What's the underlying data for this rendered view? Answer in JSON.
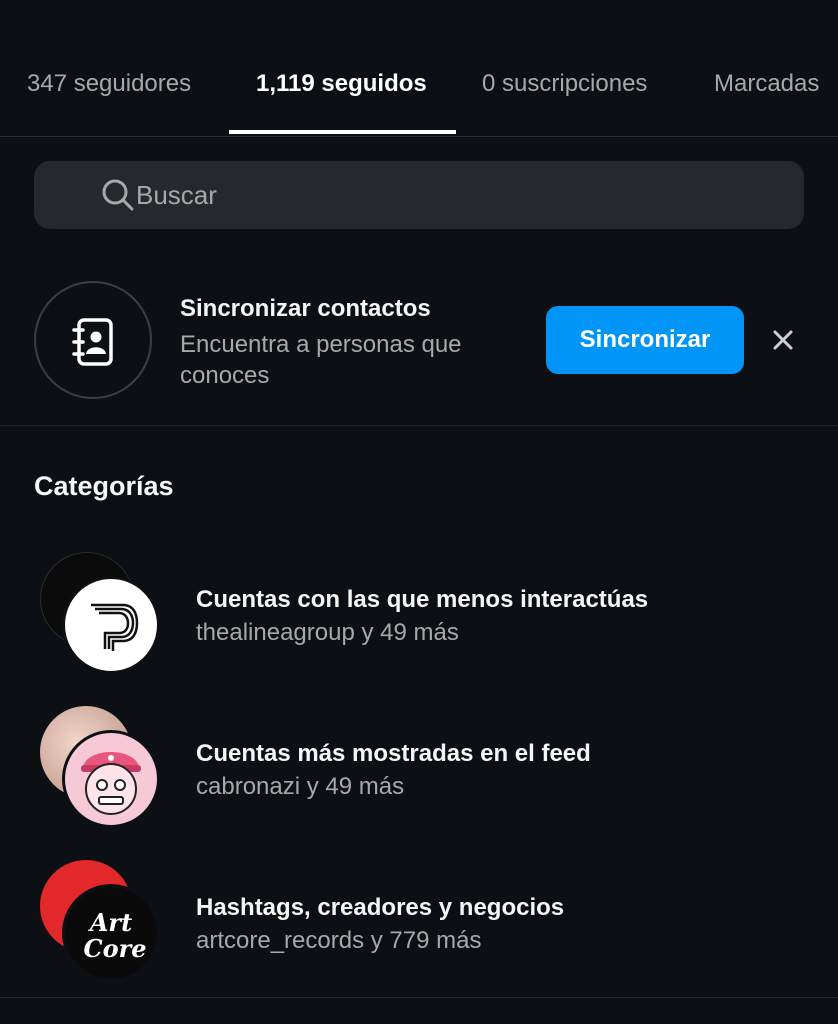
{
  "tabs": {
    "followers": "347 seguidores",
    "following": "1,119 seguidos",
    "subscriptions": "0 suscripciones",
    "tagged": "Marcadas",
    "active_tab": "following"
  },
  "search": {
    "placeholder": "Buscar"
  },
  "sync": {
    "title": "Sincronizar contactos",
    "subtitle": "Encuentra a personas que conoces",
    "button": "Sincronizar"
  },
  "categories": {
    "title": "Categorías",
    "items": [
      {
        "title": "Cuentas con las que menos interactúas",
        "subtitle": "thealineagroup y 49 más"
      },
      {
        "title": "Cuentas más mostradas en el feed",
        "subtitle": "cabronazi y 49 más"
      },
      {
        "title": "Hashtags, creadores y negocios",
        "subtitle": "artcore_records y 779 más"
      }
    ]
  },
  "colors": {
    "background": "#0c1014",
    "accent": "#0095f6",
    "secondary_text": "#a8a8a8",
    "search_bg": "#25292e"
  },
  "logos": {
    "artcore": "Art Core"
  }
}
